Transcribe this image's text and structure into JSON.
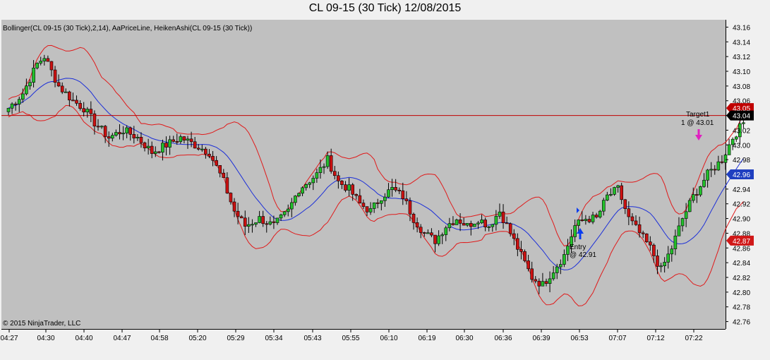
{
  "chart_data": {
    "type": "candlestick",
    "title": "CL 09-15 (30 Tick)  12/08/2015",
    "indicator_label": "Bollinger(CL 09-15 (30 Tick),2,14), AaPriceLine, HeikenAshi(CL 09-15 (30 Tick))",
    "copyright": "© 2015 NinjaTrader, LLC",
    "ylim": [
      42.75,
      43.17
    ],
    "y_ticks": [
      "43.16",
      "43.14",
      "43.12",
      "43.10",
      "43.08",
      "43.06",
      "43.04",
      "43.02",
      "43.00",
      "42.98",
      "42.96",
      "42.94",
      "42.92",
      "42.90",
      "42.88",
      "42.86",
      "42.84",
      "42.82",
      "42.80",
      "42.78",
      "42.76"
    ],
    "x_labels": [
      "04:27",
      "04:30",
      "04:40",
      "04:47",
      "04:58",
      "05:20",
      "05:29",
      "05:34",
      "05:43",
      "05:55",
      "06:10",
      "06:19",
      "06:30",
      "06:36",
      "06:39",
      "06:53",
      "07:07",
      "07:12",
      "07:22"
    ],
    "bars_count": 206,
    "price_line": {
      "value": 43.04,
      "label": "43.04",
      "hidden_label": "43.05",
      "color": "#c00000"
    },
    "markers": [
      {
        "label": "42.96",
        "value": 42.96,
        "color": "#1f3fc0"
      },
      {
        "label": "42.87",
        "value": 42.87,
        "color": "#d01818"
      }
    ],
    "annotations": {
      "entry_line1": "Entry",
      "entry_line2": "@ 42.91",
      "target_line1": "Target1",
      "target_line2": "1 @ 43.01"
    },
    "colors": {
      "up": "#22c02a",
      "down": "#cc1111",
      "bands": "#e01a1a",
      "mid": "#1c2fd8",
      "background": "#c0c0c0"
    },
    "grid": false
  }
}
